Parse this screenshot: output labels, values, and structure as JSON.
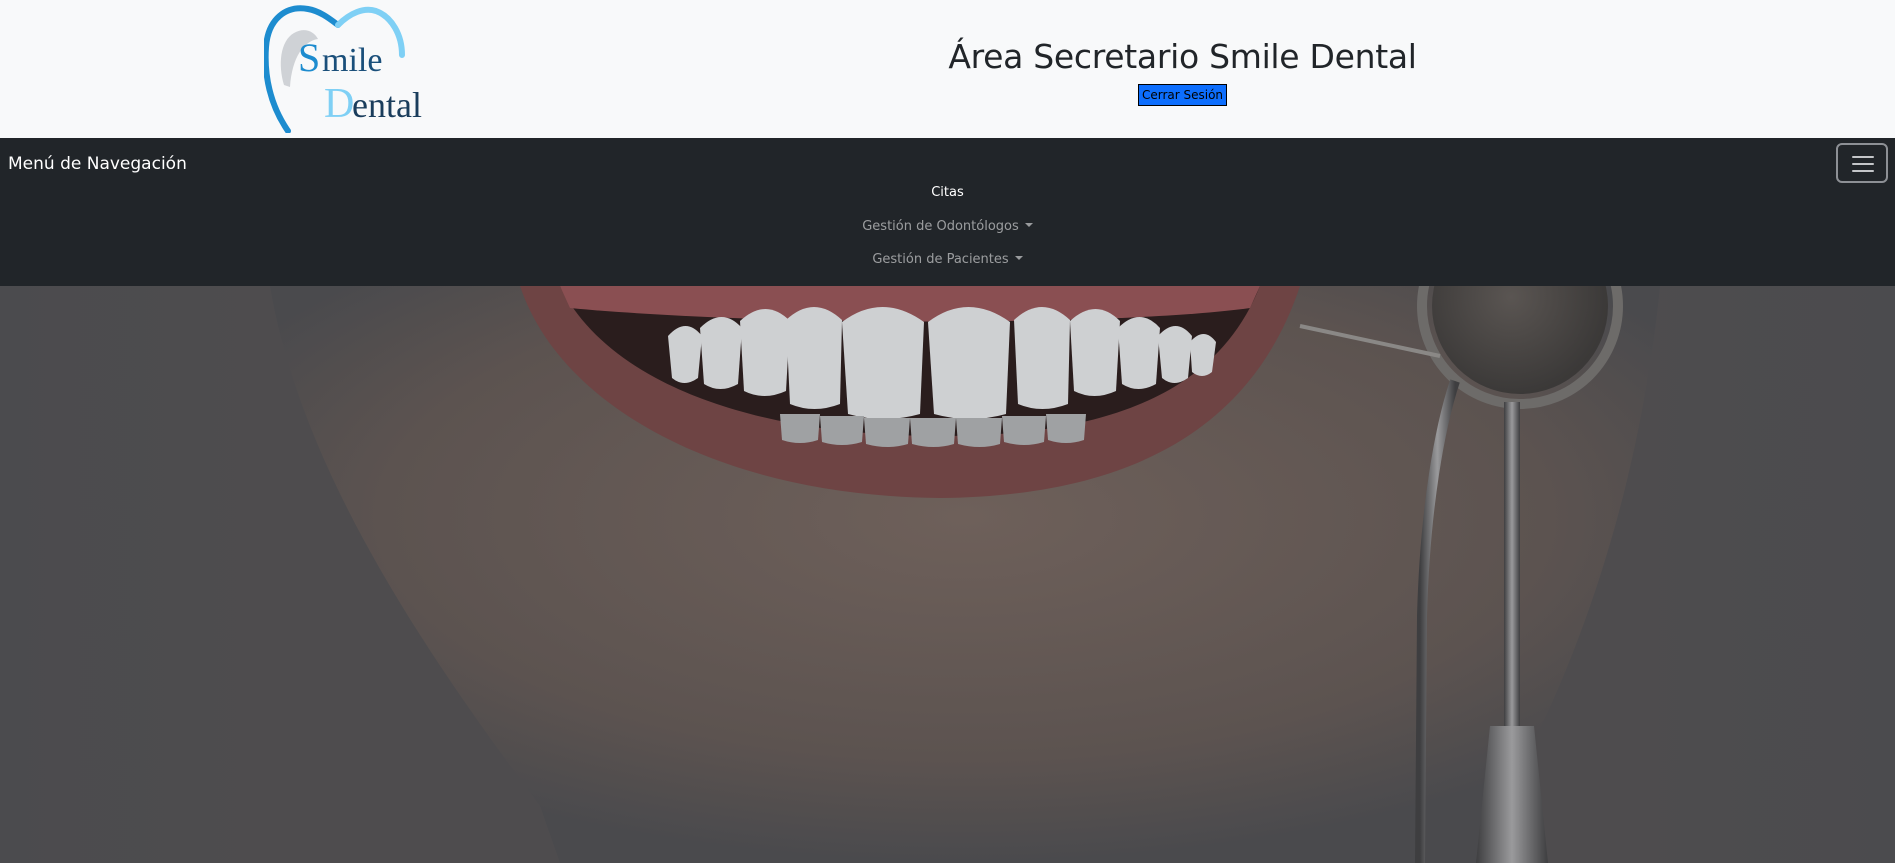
{
  "header": {
    "logo": {
      "line1": "Smile",
      "line2": "Dental",
      "initial1": "S",
      "rest1": "mile",
      "initial2": "D",
      "rest2": "ental"
    },
    "title": "Área Secretario Smile Dental",
    "logout_label": "Cerrar Sesión"
  },
  "navbar": {
    "brand": "Menú de Navegación",
    "toggler_icon": "hamburger-icon",
    "items": [
      {
        "label": "Citas",
        "active": true,
        "dropdown": false
      },
      {
        "label": "Gestión de Odontólogos",
        "active": false,
        "dropdown": true
      },
      {
        "label": "Gestión de Pacientes",
        "active": false,
        "dropdown": true
      }
    ]
  },
  "hero": {
    "image": "smiling-teeth-with-dental-mirror"
  },
  "colors": {
    "header_bg": "#f8f9fa",
    "navbar_bg": "#212529",
    "logout_button": "#0d6efd",
    "logo_dark_blue": "#1d8ccf",
    "logo_light_blue": "#7fd0f5"
  }
}
